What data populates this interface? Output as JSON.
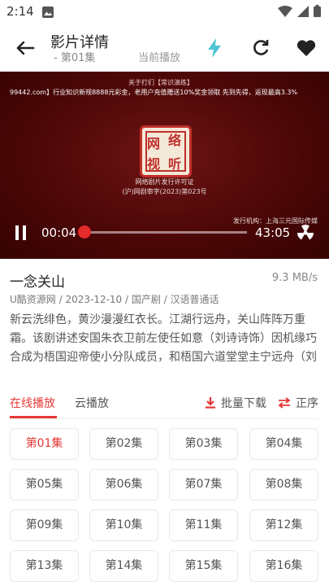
{
  "status_bar": {
    "time": "2:14"
  },
  "header": {
    "title": "影片详情",
    "subtitle": "- 第01集",
    "now_playing": "当前播放"
  },
  "player": {
    "ticker_top": "关于打们【常识演练】",
    "ticker": "99442.com】行业知识新规8888元彩金，老用户充值赠送10%奖金领取 先到先得，返现最高3.3%",
    "seal_chars": [
      "网",
      "络",
      "视",
      "听"
    ],
    "cert_line1": "网络剧片发行许可证",
    "cert_line2": "(沪)网剧审字(2023)第023号",
    "corner_note": "发行机构：上海三元国际传媒",
    "current_time": "00:04",
    "duration": "43:05",
    "progress": 0.0015
  },
  "info": {
    "name": "一念关山",
    "speed": "9.3 MB/s",
    "meta": "U酷资源网 / 2023-12-10 / 国产剧 / 汉语普通话",
    "description": "新云洗绯色，黄沙漫漫红衣长。江湖行远舟，关山阵阵万重霜。该剧讲述安国朱衣卫前左使任如意（刘诗诗饰）因机缘巧合成为梧国迎帝使小分队成员，和梧国六道堂堂主宁远舟（刘宇宁饰）、风流浪子于十三（方逸伦饰）、公主杨盈（李纯饰）等人共同踏上迎帝之路。"
  },
  "tabs": [
    {
      "label": "在线播放"
    },
    {
      "label": "云播放"
    }
  ],
  "actions": {
    "batch_download": "批量下载",
    "order": "正序"
  },
  "episodes": [
    "第01集",
    "第02集",
    "第03集",
    "第04集",
    "第05集",
    "第06集",
    "第07集",
    "第08集",
    "第09集",
    "第10集",
    "第11集",
    "第12集",
    "第13集",
    "第14集",
    "第15集",
    "第16集"
  ],
  "colors": {
    "accent": "#e53935",
    "lightning": "#4dc6d4"
  }
}
